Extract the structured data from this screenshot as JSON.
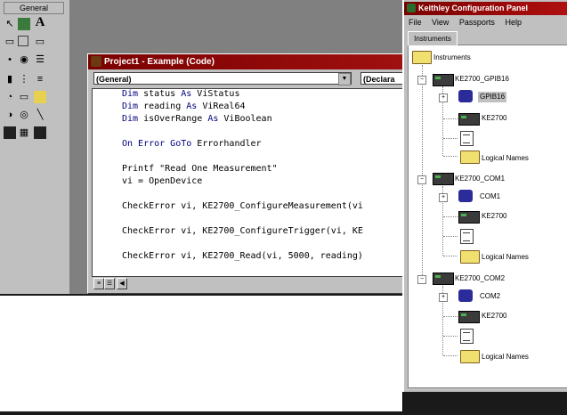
{
  "toolbox": {
    "title": "General",
    "tools": [
      "A"
    ]
  },
  "code_window": {
    "title": "Project1 - Example (Code)",
    "object_combo": "(General)",
    "proc_combo": "(Declara",
    "lines": [
      [
        "Dim",
        " status ",
        "As",
        " ViStatus"
      ],
      [
        "Dim",
        " reading ",
        "As",
        " ViReal64"
      ],
      [
        "Dim",
        " isOverRange ",
        "As",
        " ViBoolean"
      ],
      [
        "On Error GoTo",
        " Errorhandler",
        "",
        ""
      ],
      [
        "",
        "Printf \"Read One Measurement\"",
        "",
        ""
      ],
      [
        "",
        "vi = OpenDevice",
        "",
        ""
      ],
      [
        "",
        "CheckError vi, KE2700_ConfigureMeasurement(vi",
        "",
        ""
      ],
      [
        "",
        "CheckError vi, KE2700_ConfigureTrigger(vi, KE",
        "",
        ""
      ],
      [
        "",
        "CheckError vi, KE2700_Read(vi, 5000, reading)",
        "",
        ""
      ]
    ]
  },
  "keithley": {
    "title": "Keithley Configuration Panel",
    "menu": [
      "File",
      "View",
      "Passports",
      "Help"
    ],
    "tab": "Instruments",
    "tree": {
      "root": "Instruments",
      "instruments": [
        {
          "name": "KE2700_GPIB16",
          "interface": "GPIB16",
          "model": "KE2700",
          "logical": "Logical Names"
        },
        {
          "name": "KE2700_COM1",
          "interface": "COM1",
          "model": "KE2700",
          "logical": "Logical Names"
        },
        {
          "name": "KE2700_COM2",
          "interface": "COM2",
          "model": "KE2700",
          "logical": "Logical Names"
        }
      ]
    }
  }
}
